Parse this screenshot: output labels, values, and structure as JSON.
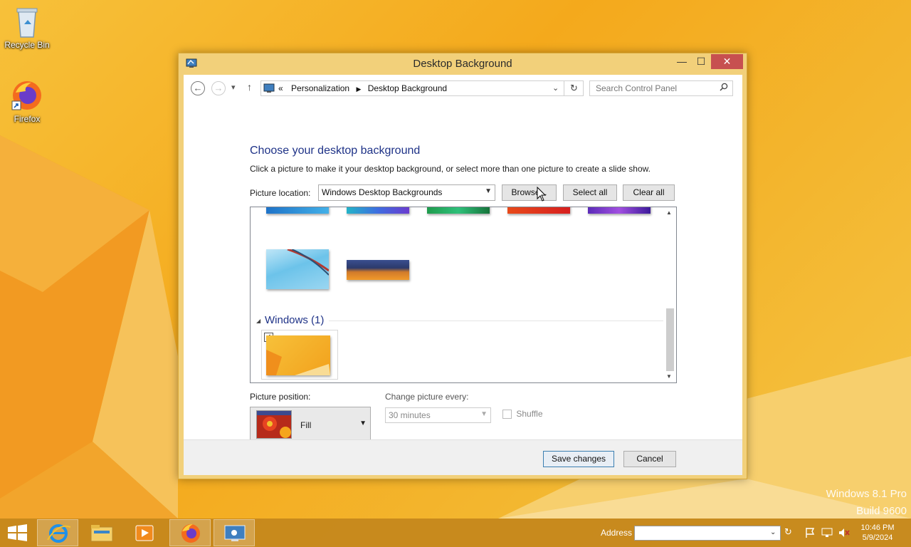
{
  "desktop": {
    "icons": [
      {
        "label": "Recycle Bin",
        "icon": "recycle-bin-icon"
      },
      {
        "label": "Firefox",
        "icon": "firefox-icon"
      }
    ],
    "watermark_line1": "Windows 8.1 Pro",
    "watermark_line2": "Build 9600"
  },
  "window": {
    "title": "Desktop Background",
    "controls": {
      "minimize": "—",
      "maximize": "☐",
      "close": "✕"
    },
    "nav": {
      "back": "←",
      "forward": "→",
      "recent": "▾",
      "up": "↑",
      "breadcrumb_prefix": "«",
      "breadcrumbs": [
        "Personalization",
        "Desktop Background"
      ],
      "refresh": "↻",
      "search_placeholder": "Search Control Panel"
    },
    "heading": "Choose your desktop background",
    "description": "Click a picture to make it your desktop background, or select more than one picture to create a slide show.",
    "picture_location": {
      "label": "Picture location:",
      "value": "Windows Desktop Backgrounds",
      "browse_label": "Browse...",
      "select_all_label": "Select all",
      "clear_all_label": "Clear all"
    },
    "picture_list": {
      "group_header": "Windows (1)",
      "selected_checked": "✓"
    },
    "picture_position": {
      "label": "Picture position:",
      "value": "Fill"
    },
    "change_picture": {
      "label": "Change picture every:",
      "value": "30 minutes",
      "shuffle_label": "Shuffle"
    },
    "footer": {
      "save_label": "Save changes",
      "cancel_label": "Cancel"
    }
  },
  "taskbar": {
    "items": [
      {
        "icon": "start-icon"
      },
      {
        "icon": "internet-explorer-icon"
      },
      {
        "icon": "file-explorer-icon"
      },
      {
        "icon": "media-player-icon"
      },
      {
        "icon": "firefox-icon"
      },
      {
        "icon": "control-panel-icon"
      }
    ],
    "address_label": "Address",
    "time": "10:46 PM",
    "date": "5/9/2024"
  }
}
